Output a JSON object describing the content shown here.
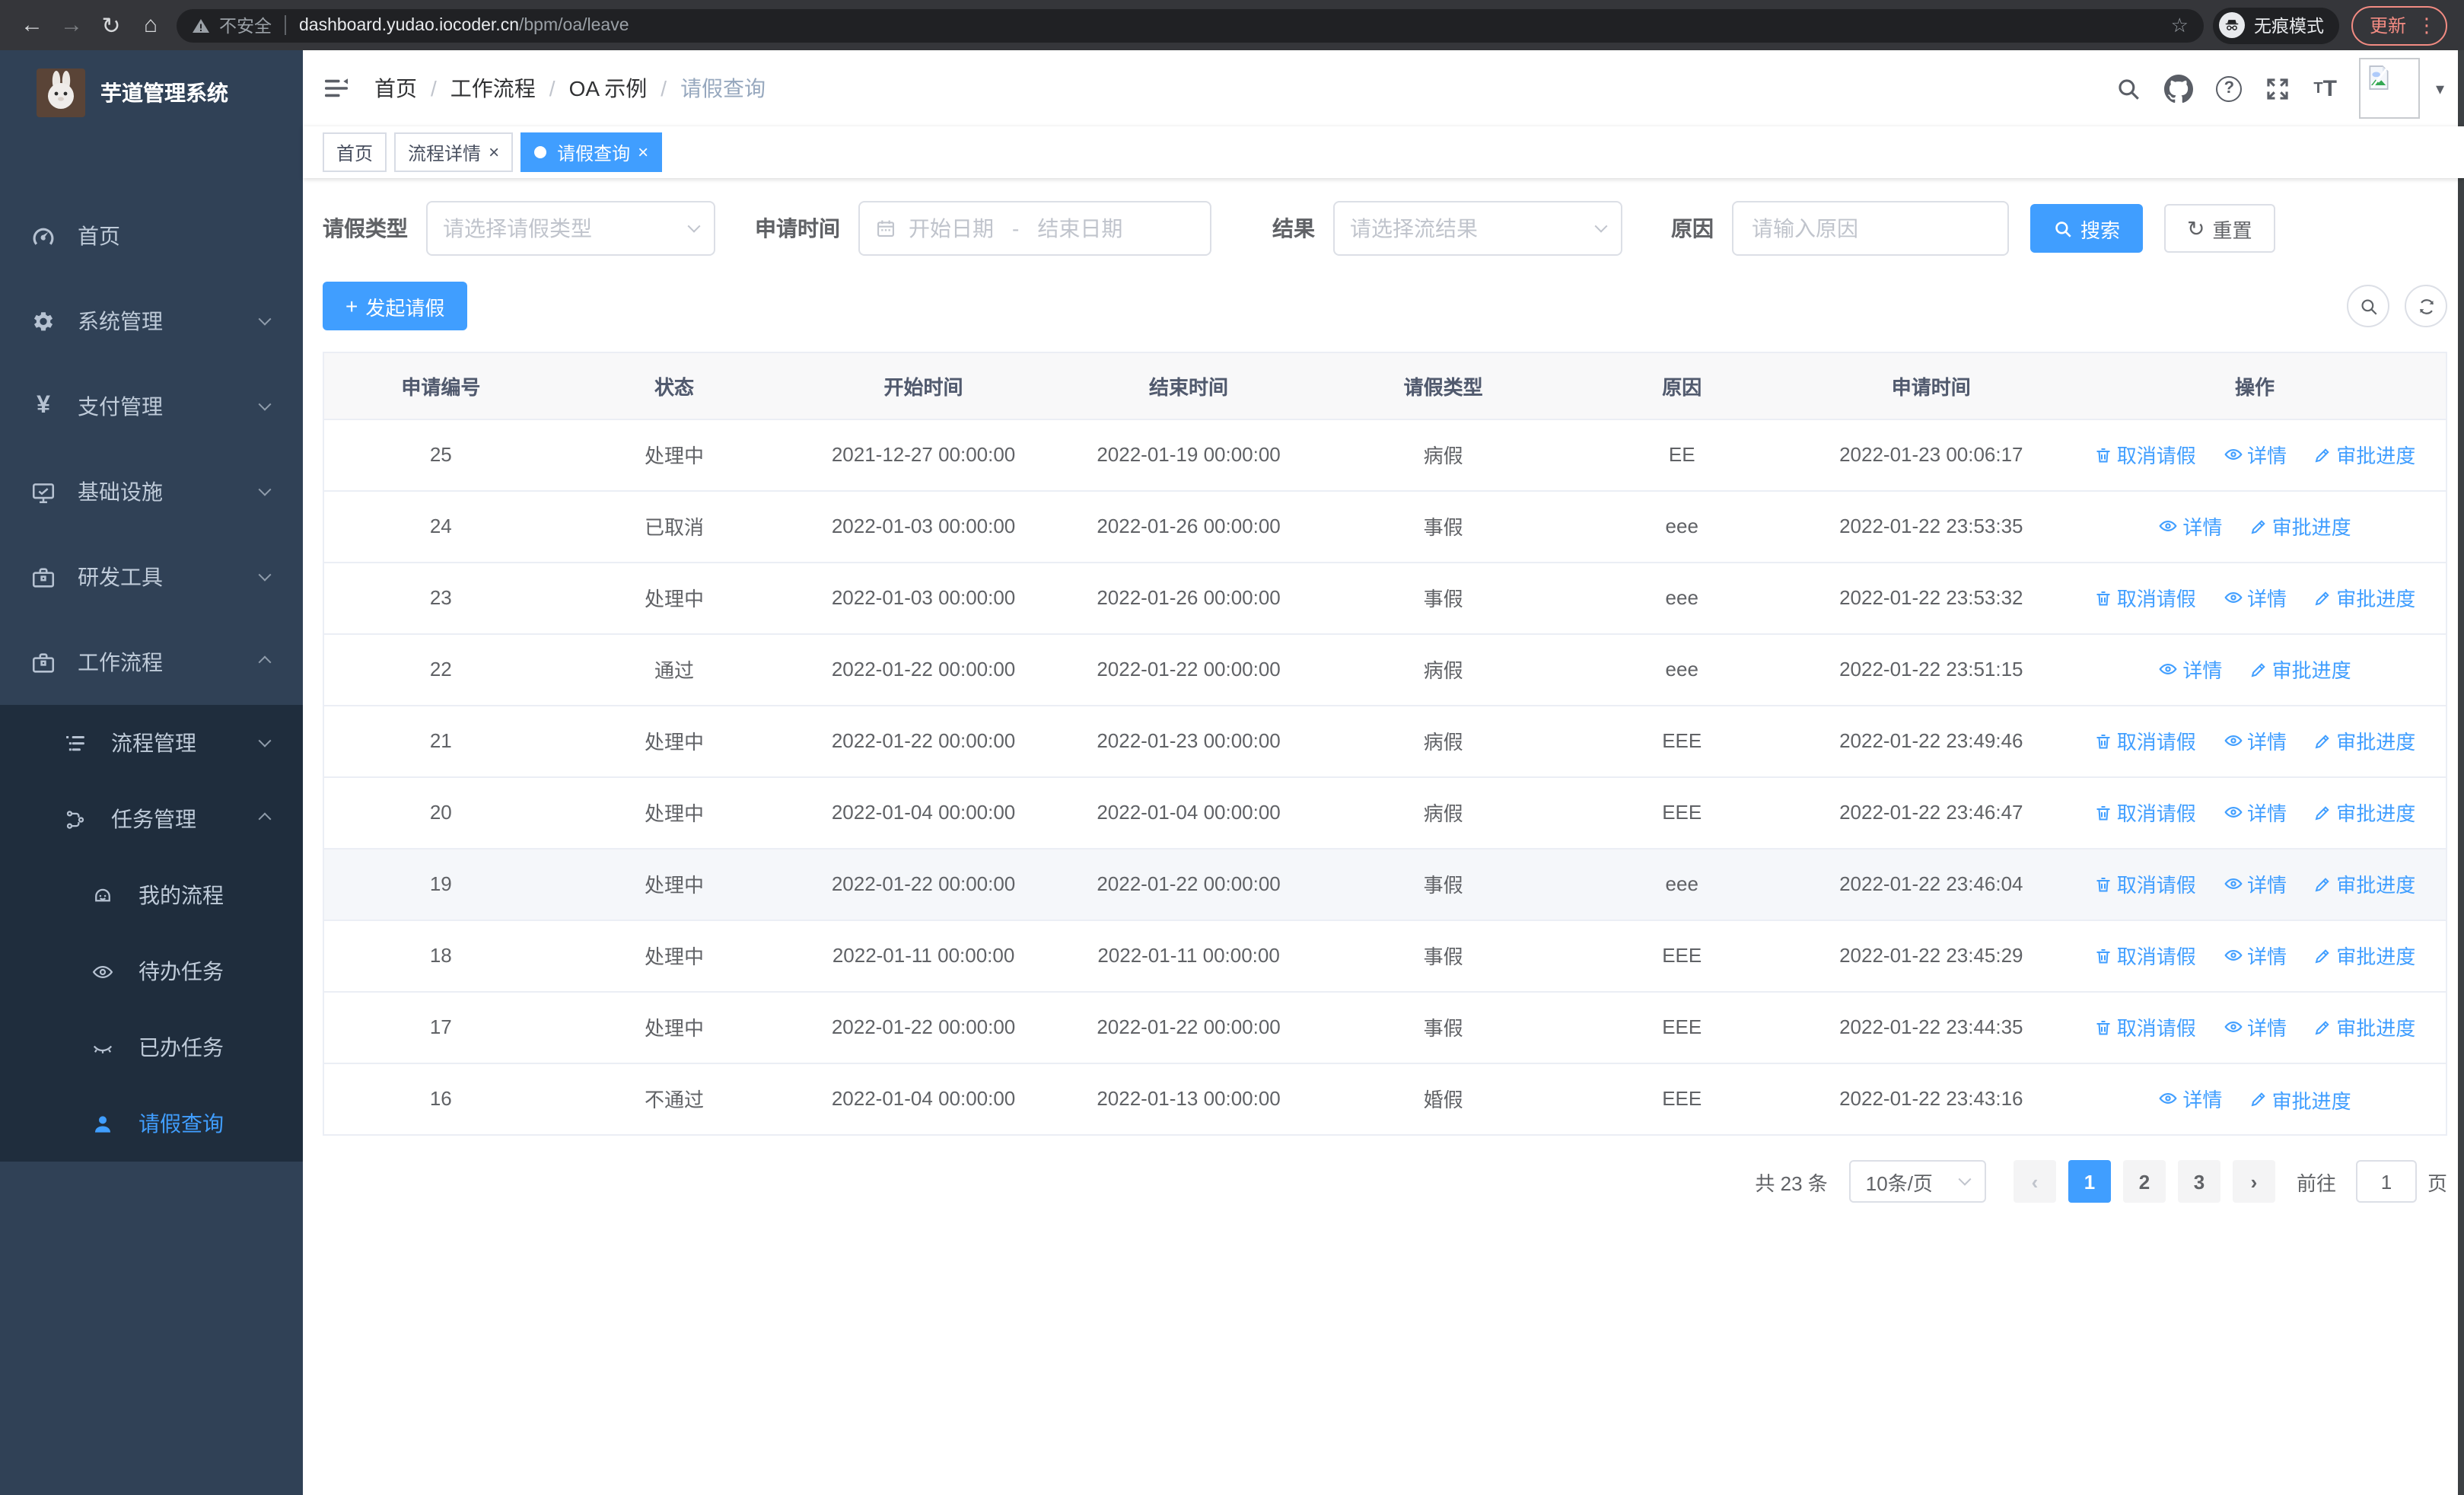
{
  "chrome": {
    "security": "不安全",
    "url_host": "dashboard.yudao.iocoder.cn",
    "url_path": "/bpm/oa/leave",
    "incognito": "无痕模式",
    "update": "更新"
  },
  "sidebar": {
    "title": "芋道管理系统",
    "items": [
      {
        "label": "首页"
      },
      {
        "label": "系统管理"
      },
      {
        "label": "支付管理"
      },
      {
        "label": "基础设施"
      },
      {
        "label": "研发工具"
      },
      {
        "label": "工作流程"
      }
    ],
    "workflow_children": [
      {
        "label": "流程管理"
      },
      {
        "label": "任务管理"
      }
    ],
    "task_children": [
      {
        "label": "我的流程"
      },
      {
        "label": "待办任务"
      },
      {
        "label": "已办任务"
      },
      {
        "label": "请假查询"
      }
    ]
  },
  "breadcrumb": {
    "items": [
      "首页",
      "工作流程",
      "OA 示例",
      "请假查询"
    ]
  },
  "tabs": [
    {
      "label": "首页"
    },
    {
      "label": "流程详情"
    },
    {
      "label": "请假查询"
    }
  ],
  "filters": {
    "leave_type_label": "请假类型",
    "leave_type_placeholder": "请选择请假类型",
    "apply_time_label": "申请时间",
    "date_start_placeholder": "开始日期",
    "date_separator": "-",
    "date_end_placeholder": "结束日期",
    "result_label": "结果",
    "result_placeholder": "请选择流结果",
    "reason_label": "原因",
    "reason_placeholder": "请输入原因",
    "search_label": "搜索",
    "reset_label": "重置"
  },
  "toolbar": {
    "create_label": "发起请假"
  },
  "table": {
    "headers": [
      "申请编号",
      "状态",
      "开始时间",
      "结束时间",
      "请假类型",
      "原因",
      "申请时间",
      "操作"
    ],
    "actions": {
      "cancel": "取消请假",
      "detail": "详情",
      "progress": "审批进度"
    },
    "rows": [
      {
        "id": "25",
        "status": "处理中",
        "start": "2021-12-27 00:00:00",
        "end": "2022-01-19 00:00:00",
        "type": "病假",
        "reason": "EE",
        "applied": "2022-01-23 00:06:17",
        "cancelable": true,
        "highlighted": false
      },
      {
        "id": "24",
        "status": "已取消",
        "start": "2022-01-03 00:00:00",
        "end": "2022-01-26 00:00:00",
        "type": "事假",
        "reason": "eee",
        "applied": "2022-01-22 23:53:35",
        "cancelable": false,
        "highlighted": false
      },
      {
        "id": "23",
        "status": "处理中",
        "start": "2022-01-03 00:00:00",
        "end": "2022-01-26 00:00:00",
        "type": "事假",
        "reason": "eee",
        "applied": "2022-01-22 23:53:32",
        "cancelable": true,
        "highlighted": false
      },
      {
        "id": "22",
        "status": "通过",
        "start": "2022-01-22 00:00:00",
        "end": "2022-01-22 00:00:00",
        "type": "病假",
        "reason": "eee",
        "applied": "2022-01-22 23:51:15",
        "cancelable": false,
        "highlighted": false
      },
      {
        "id": "21",
        "status": "处理中",
        "start": "2022-01-22 00:00:00",
        "end": "2022-01-23 00:00:00",
        "type": "病假",
        "reason": "EEE",
        "applied": "2022-01-22 23:49:46",
        "cancelable": true,
        "highlighted": false
      },
      {
        "id": "20",
        "status": "处理中",
        "start": "2022-01-04 00:00:00",
        "end": "2022-01-04 00:00:00",
        "type": "病假",
        "reason": "EEE",
        "applied": "2022-01-22 23:46:47",
        "cancelable": true,
        "highlighted": false
      },
      {
        "id": "19",
        "status": "处理中",
        "start": "2022-01-22 00:00:00",
        "end": "2022-01-22 00:00:00",
        "type": "事假",
        "reason": "eee",
        "applied": "2022-01-22 23:46:04",
        "cancelable": true,
        "highlighted": true
      },
      {
        "id": "18",
        "status": "处理中",
        "start": "2022-01-11 00:00:00",
        "end": "2022-01-11 00:00:00",
        "type": "事假",
        "reason": "EEE",
        "applied": "2022-01-22 23:45:29",
        "cancelable": true,
        "highlighted": false
      },
      {
        "id": "17",
        "status": "处理中",
        "start": "2022-01-22 00:00:00",
        "end": "2022-01-22 00:00:00",
        "type": "事假",
        "reason": "EEE",
        "applied": "2022-01-22 23:44:35",
        "cancelable": true,
        "highlighted": false
      },
      {
        "id": "16",
        "status": "不通过",
        "start": "2022-01-04 00:00:00",
        "end": "2022-01-13 00:00:00",
        "type": "婚假",
        "reason": "EEE",
        "applied": "2022-01-22 23:43:16",
        "cancelable": false,
        "highlighted": false
      }
    ]
  },
  "pagination": {
    "total": "共 23 条",
    "size": "10条/页",
    "pages": [
      "1",
      "2",
      "3"
    ],
    "active_page": "1",
    "goto": "前往",
    "goto_value": "1",
    "unit": "页"
  },
  "colors": {
    "accent": "#409eff",
    "sidebar_bg": "#304156",
    "submenu_bg": "#1f2d3d",
    "sidebar_text": "#bfcbd9",
    "table_header_bg": "#f8f8f9",
    "table_border": "#ebeef5",
    "update_accent": "#f28b82"
  }
}
